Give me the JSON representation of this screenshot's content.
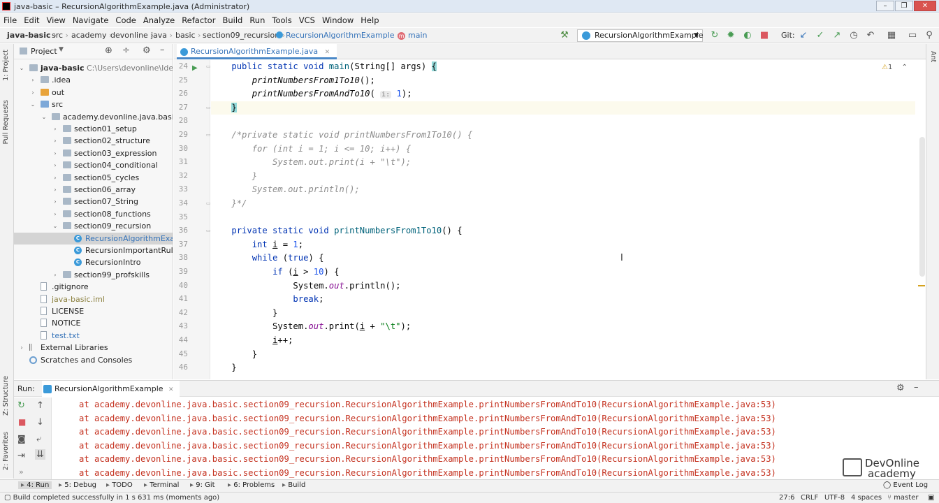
{
  "window": {
    "title": "java-basic – RecursionAlgorithmExample.java (Administrator)",
    "min": "–",
    "max": "❐",
    "close": "✕"
  },
  "menu": [
    "File",
    "Edit",
    "View",
    "Navigate",
    "Code",
    "Analyze",
    "Refactor",
    "Build",
    "Run",
    "Tools",
    "VCS",
    "Window",
    "Help"
  ],
  "breadcrumb": [
    "java-basic",
    "src",
    "academy",
    "devonline",
    "java",
    "basic",
    "section09_recursion",
    "RecursionAlgorithmExample",
    "main"
  ],
  "toolbar": {
    "run_config": "RecursionAlgorithmExample",
    "git_label": "Git:"
  },
  "left_stripe": {
    "project": "1: Project",
    "pull_requests": "Pull Requests",
    "structure": "Z: Structure",
    "favorites": "2: Favorites"
  },
  "right_stripe": {
    "ant": "Ant"
  },
  "project_panel": {
    "title": "Project",
    "tree": [
      {
        "label": "java-basic",
        "extra": "C:\\Users\\devonline\\IdeaProje",
        "depth": 0,
        "open": true,
        "icon": "folder",
        "bold": true
      },
      {
        "label": ".idea",
        "depth": 1,
        "open": false,
        "icon": "folder"
      },
      {
        "label": "out",
        "depth": 1,
        "open": false,
        "icon": "orange"
      },
      {
        "label": "src",
        "depth": 1,
        "open": true,
        "icon": "blue"
      },
      {
        "label": "academy.devonline.java.basic",
        "depth": 2,
        "open": true,
        "icon": "pkg"
      },
      {
        "label": "section01_setup",
        "depth": 3,
        "open": false,
        "icon": "pkg"
      },
      {
        "label": "section02_structure",
        "depth": 3,
        "open": false,
        "icon": "pkg"
      },
      {
        "label": "section03_expression",
        "depth": 3,
        "open": false,
        "icon": "pkg"
      },
      {
        "label": "section04_conditional",
        "depth": 3,
        "open": false,
        "icon": "pkg"
      },
      {
        "label": "section05_cycles",
        "depth": 3,
        "open": false,
        "icon": "pkg"
      },
      {
        "label": "section06_array",
        "depth": 3,
        "open": false,
        "icon": "pkg"
      },
      {
        "label": "section07_String",
        "depth": 3,
        "open": false,
        "icon": "pkg"
      },
      {
        "label": "section08_functions",
        "depth": 3,
        "open": false,
        "icon": "pkg"
      },
      {
        "label": "section09_recursion",
        "depth": 3,
        "open": true,
        "icon": "pkg"
      },
      {
        "label": "RecursionAlgorithmExampl",
        "depth": 4,
        "icon": "class",
        "selected": true
      },
      {
        "label": "RecursionImportantRule",
        "depth": 4,
        "icon": "class"
      },
      {
        "label": "RecursionIntro",
        "depth": 4,
        "icon": "class"
      },
      {
        "label": "section99_profskills",
        "depth": 3,
        "open": false,
        "icon": "pkg"
      },
      {
        "label": ".gitignore",
        "depth": 1,
        "icon": "doc"
      },
      {
        "label": "java-basic.iml",
        "depth": 1,
        "icon": "doc",
        "color": "#8a7f3d"
      },
      {
        "label": "LICENSE",
        "depth": 1,
        "icon": "doc"
      },
      {
        "label": "NOTICE",
        "depth": 1,
        "icon": "doc"
      },
      {
        "label": "test.txt",
        "depth": 1,
        "icon": "doc",
        "color": "#3573b9"
      },
      {
        "label": "External Libraries",
        "depth": 0,
        "open": false,
        "icon": "lib"
      },
      {
        "label": "Scratches and Consoles",
        "depth": 0,
        "icon": "scratch"
      }
    ]
  },
  "editor": {
    "tab": "RecursionAlgorithmExample.java",
    "inspection_count": "1",
    "lines": [
      {
        "n": "24",
        "html": "    <span class=\"kw\">public static void</span> <span class=\"meth\">main</span>(String[] args) <span class=\"brk\">{</span>"
      },
      {
        "n": "25",
        "html": "        <span class=\"ital\">printNumbersFrom1To10</span>();"
      },
      {
        "n": "26",
        "html": "        <span class=\"ital\">printNumbersFromAndTo10</span>( <span class=\"hint\">i:</span> <span class=\"num\">1</span>);"
      },
      {
        "n": "27",
        "html": "    <span class=\"brk\">}</span>",
        "current": true
      },
      {
        "n": "28",
        "html": ""
      },
      {
        "n": "29",
        "html": "    <span class=\"cmt\">/*private static void printNumbersFrom1To10() {</span>"
      },
      {
        "n": "30",
        "html": "    <span class=\"cmt\">    for (int i = 1; i &lt;= 10; i++) {</span>"
      },
      {
        "n": "31",
        "html": "    <span class=\"cmt\">        System.out.print(i + \"\\t\");</span>"
      },
      {
        "n": "32",
        "html": "    <span class=\"cmt\">    }</span>"
      },
      {
        "n": "33",
        "html": "    <span class=\"cmt\">    System.out.println();</span>"
      },
      {
        "n": "34",
        "html": "    <span class=\"cmt\">}*/</span>"
      },
      {
        "n": "35",
        "html": ""
      },
      {
        "n": "36",
        "html": "    <span class=\"kw\">private static void</span> <span class=\"meth\">printNumbersFrom1To10</span>() {"
      },
      {
        "n": "37",
        "html": "        <span class=\"kw\">int</span> <u>i</u> = <span class=\"num\">1</span>;"
      },
      {
        "n": "38",
        "html": "        <span class=\"kw\">while</span> (<span class=\"kw\">true</span>) {"
      },
      {
        "n": "39",
        "html": "            <span class=\"kw\">if</span> (<u>i</u> &gt; <span class=\"num\">10</span>) {"
      },
      {
        "n": "40",
        "html": "                System.<span class=\"fld\">out</span>.println();"
      },
      {
        "n": "41",
        "html": "                <span class=\"kw\">break</span>;"
      },
      {
        "n": "42",
        "html": "            }"
      },
      {
        "n": "43",
        "html": "            System.<span class=\"fld\">out</span>.print(<u>i</u> + <span class=\"str\">\"\\t\"</span>);"
      },
      {
        "n": "44",
        "html": "            <u>i</u>++;"
      },
      {
        "n": "45",
        "html": "        }"
      },
      {
        "n": "46",
        "html": "    }"
      }
    ]
  },
  "run_panel": {
    "label": "Run:",
    "tab": "RecursionAlgorithmExample",
    "output": [
      "at academy.devonline.java.basic.section09_recursion.RecursionAlgorithmExample.printNumbersFromAndTo10(RecursionAlgorithmExample.java:53)",
      "at academy.devonline.java.basic.section09_recursion.RecursionAlgorithmExample.printNumbersFromAndTo10(RecursionAlgorithmExample.java:53)",
      "at academy.devonline.java.basic.section09_recursion.RecursionAlgorithmExample.printNumbersFromAndTo10(RecursionAlgorithmExample.java:53)",
      "at academy.devonline.java.basic.section09_recursion.RecursionAlgorithmExample.printNumbersFromAndTo10(RecursionAlgorithmExample.java:53)",
      "at academy.devonline.java.basic.section09_recursion.RecursionAlgorithmExample.printNumbersFromAndTo10(RecursionAlgorithmExample.java:53)",
      "at academy.devonline.java.basic.section09_recursion.RecursionAlgorithmExample.printNumbersFromAndTo10(RecursionAlgorithmExample.java:53)"
    ]
  },
  "bottom_tools": [
    {
      "name": "run",
      "label": "4: Run"
    },
    {
      "name": "debug",
      "label": "5: Debug"
    },
    {
      "name": "todo",
      "label": "TODO"
    },
    {
      "name": "terminal",
      "label": "Terminal"
    },
    {
      "name": "git",
      "label": "9: Git"
    },
    {
      "name": "problems",
      "label": "6: Problems"
    },
    {
      "name": "build",
      "label": "Build"
    }
  ],
  "event_log": "Event Log",
  "status": {
    "message": "Build completed successfully in 1 s 631 ms (moments ago)",
    "position": "27:6",
    "line_sep": "CRLF",
    "encoding": "UTF-8",
    "indent": "4 spaces",
    "branch": "master"
  },
  "logo": {
    "line1": "DevOnline",
    "line2": "academy"
  },
  "colors": {
    "error_text": "#c4311f",
    "keyword": "#0033b3",
    "accent": "#4a88c7",
    "run_green": "#499c54",
    "stop_red": "#db5860"
  }
}
